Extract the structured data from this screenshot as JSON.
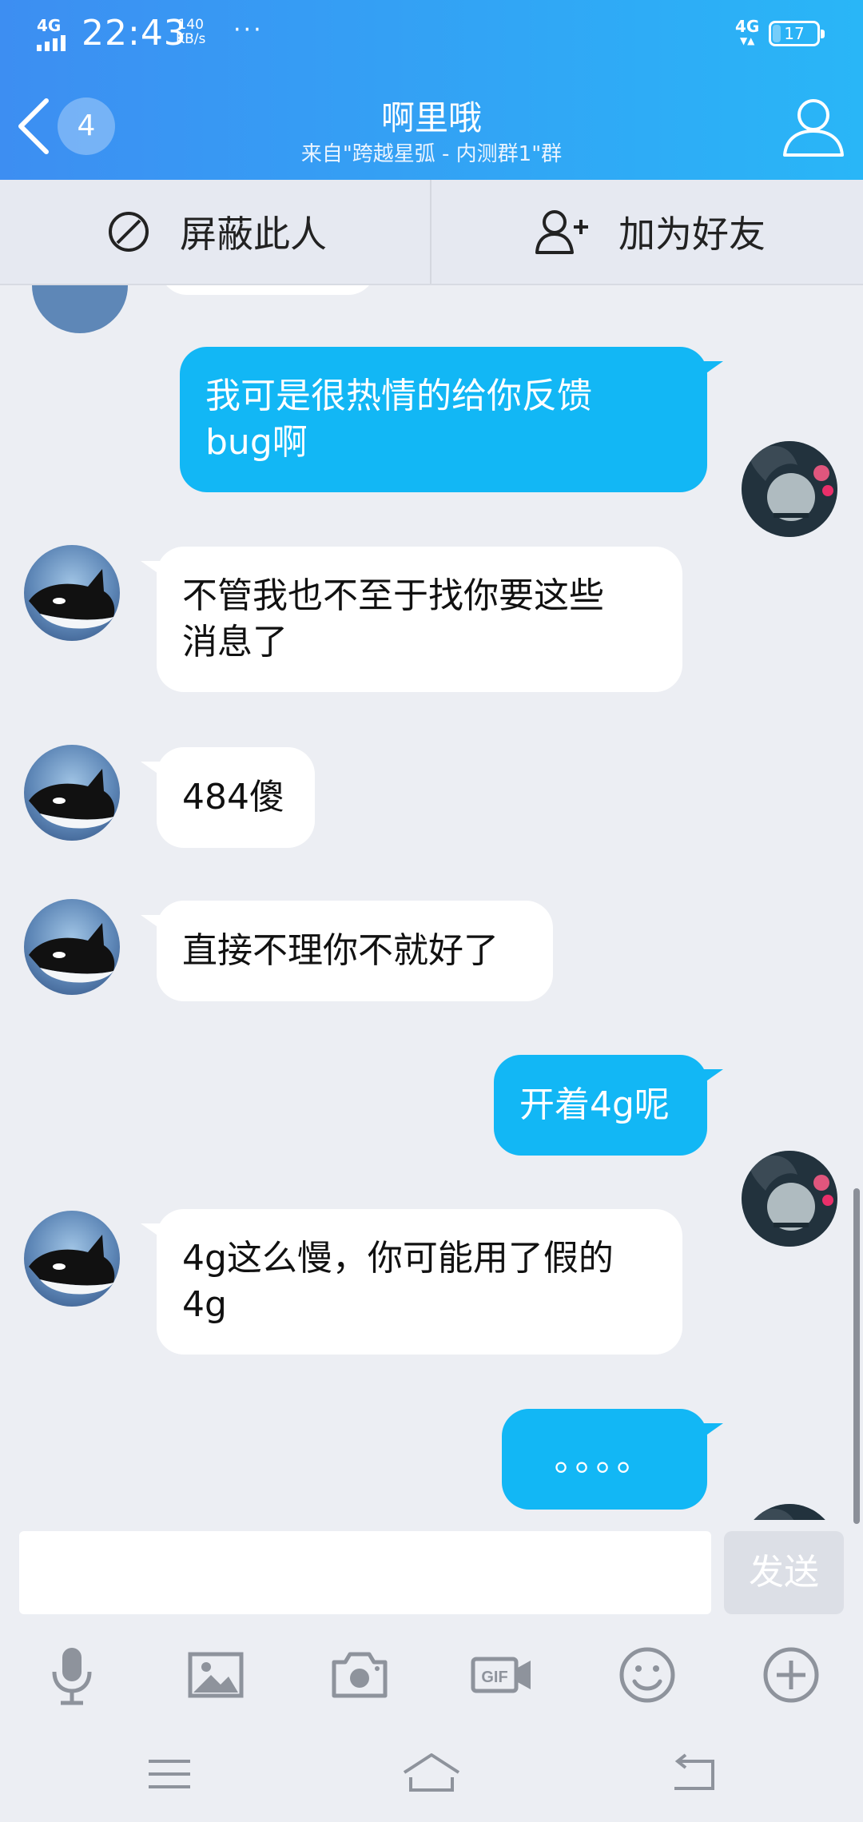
{
  "status_bar": {
    "network": "4G",
    "time": "22:43",
    "speed_value": "140",
    "speed_unit": "KB/s",
    "more": "···",
    "network_right": "4G",
    "battery": "17"
  },
  "header": {
    "badge_count": "4",
    "title": "啊里哦",
    "subtitle": "来自\"跨越星弧 - 内测群1\"群"
  },
  "actions": {
    "block_label": "屏蔽此人",
    "add_friend_label": "加为好友"
  },
  "messages": [
    {
      "from": "me",
      "text_lines": [
        "我可是很热情的给你反馈",
        "bug啊"
      ]
    },
    {
      "from": "other",
      "text_lines": [
        "不管我也不至于找你要这些",
        "消息了"
      ]
    },
    {
      "from": "other",
      "text_lines": [
        "484傻"
      ]
    },
    {
      "from": "other",
      "text_lines": [
        "直接不理你不就好了"
      ]
    },
    {
      "from": "me",
      "text_lines": [
        "开着4g呢"
      ]
    },
    {
      "from": "other",
      "text_lines": [
        "4g这么慢，你可能用了假的",
        "4g"
      ]
    },
    {
      "from": "me",
      "text_lines": [
        "。。。。"
      ]
    }
  ],
  "input": {
    "value": "",
    "send_label": "发送"
  },
  "toolbar": {
    "gif_label": "GIF"
  },
  "colors": {
    "header_start": "#3d8ef2",
    "header_end": "#29b6f7",
    "out_bubble": "#12b7f5",
    "in_bubble": "#ffffff",
    "background": "#eceef3"
  }
}
